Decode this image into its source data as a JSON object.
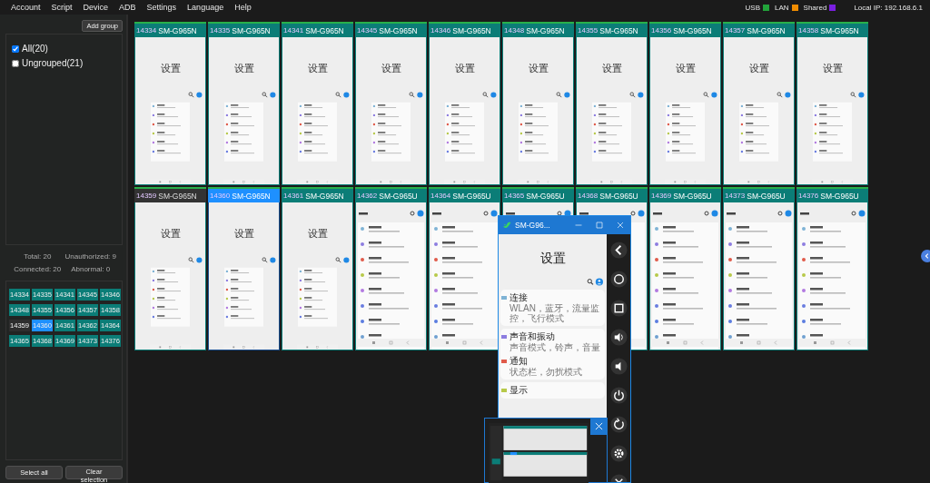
{
  "menu": [
    "Account",
    "Script",
    "Device",
    "ADB",
    "Settings",
    "Language",
    "Help"
  ],
  "legend": [
    {
      "label": "USB",
      "color": "#22a33a"
    },
    {
      "label": "LAN",
      "color": "#f08c00"
    },
    {
      "label": "Shared",
      "color": "#7a1fe0"
    }
  ],
  "local_ip": "Local IP: 192.168.6.1",
  "sidebar": {
    "add_group": "Add group",
    "groups": [
      {
        "label": "All(20)",
        "checked": true
      },
      {
        "label": "Ungrouped(21)",
        "checked": false
      }
    ],
    "stats": [
      "Total: 20",
      "Unauthorized: 9",
      "Connected: 20",
      "Abnormal: 0"
    ],
    "ports": [
      {
        "label": "14334",
        "selected": false,
        "dimmed": false
      },
      {
        "label": "14335",
        "selected": false,
        "dimmed": false
      },
      {
        "label": "14341",
        "selected": false,
        "dimmed": false
      },
      {
        "label": "14345",
        "selected": false,
        "dimmed": false
      },
      {
        "label": "14346",
        "selected": false,
        "dimmed": false
      },
      {
        "label": "14348",
        "selected": false,
        "dimmed": false
      },
      {
        "label": "14355",
        "selected": false,
        "dimmed": false
      },
      {
        "label": "14356",
        "selected": false,
        "dimmed": false
      },
      {
        "label": "14357",
        "selected": false,
        "dimmed": false
      },
      {
        "label": "14358",
        "selected": false,
        "dimmed": false
      },
      {
        "label": "14359",
        "selected": false,
        "dimmed": true
      },
      {
        "label": "14360",
        "selected": true,
        "dimmed": false
      },
      {
        "label": "14361",
        "selected": false,
        "dimmed": false
      },
      {
        "label": "14362",
        "selected": false,
        "dimmed": false
      },
      {
        "label": "14364",
        "selected": false,
        "dimmed": false
      },
      {
        "label": "14365",
        "selected": false,
        "dimmed": false
      },
      {
        "label": "14368",
        "selected": false,
        "dimmed": false
      },
      {
        "label": "14369",
        "selected": false,
        "dimmed": false
      },
      {
        "label": "14373",
        "selected": false,
        "dimmed": false
      },
      {
        "label": "14376",
        "selected": false,
        "dimmed": false
      }
    ],
    "buttons": [
      "Select all",
      "Clear selection"
    ]
  },
  "devices": [
    {
      "port": "14334",
      "model": "SM-G965N",
      "kind": "large",
      "title": "设置",
      "selected": false,
      "dimmed": false
    },
    {
      "port": "14335",
      "model": "SM-G965N",
      "kind": "large",
      "title": "设置",
      "selected": false,
      "dimmed": false
    },
    {
      "port": "14341",
      "model": "SM-G965N",
      "kind": "large",
      "title": "设置",
      "selected": false,
      "dimmed": false
    },
    {
      "port": "14345",
      "model": "SM-G965N",
      "kind": "large",
      "title": "设置",
      "selected": false,
      "dimmed": false
    },
    {
      "port": "14346",
      "model": "SM-G965N",
      "kind": "large",
      "title": "设置",
      "selected": false,
      "dimmed": false
    },
    {
      "port": "14348",
      "model": "SM-G965N",
      "kind": "large",
      "title": "设置",
      "selected": false,
      "dimmed": false
    },
    {
      "port": "14355",
      "model": "SM-G965N",
      "kind": "large",
      "title": "设置",
      "selected": false,
      "dimmed": false
    },
    {
      "port": "14356",
      "model": "SM-G965N",
      "kind": "large",
      "title": "设置",
      "selected": false,
      "dimmed": false
    },
    {
      "port": "14357",
      "model": "SM-G965N",
      "kind": "large",
      "title": "设置",
      "selected": false,
      "dimmed": false
    },
    {
      "port": "14358",
      "model": "SM-G965N",
      "kind": "large",
      "title": "设置",
      "selected": false,
      "dimmed": false
    },
    {
      "port": "14359",
      "model": "SM-G965N",
      "kind": "large",
      "title": "设置",
      "selected": false,
      "dimmed": true
    },
    {
      "port": "14360",
      "model": "SM-G965N",
      "kind": "large",
      "title": "设置",
      "selected": true,
      "dimmed": false
    },
    {
      "port": "14361",
      "model": "SM-G965N",
      "kind": "large",
      "title": "设置",
      "selected": false,
      "dimmed": false
    },
    {
      "port": "14362",
      "model": "SM-G965U",
      "kind": "compact",
      "selected": false,
      "dimmed": false
    },
    {
      "port": "14364",
      "model": "SM-G965U",
      "kind": "compact",
      "selected": false,
      "dimmed": false
    },
    {
      "port": "14365",
      "model": "SM-G965U",
      "kind": "compact",
      "selected": false,
      "dimmed": false
    },
    {
      "port": "14368",
      "model": "SM-G965U",
      "kind": "compact",
      "selected": false,
      "dimmed": false
    },
    {
      "port": "14369",
      "model": "SM-G965U",
      "kind": "compact",
      "selected": false,
      "dimmed": false
    },
    {
      "port": "14373",
      "model": "SM-G965U",
      "kind": "compact",
      "selected": false,
      "dimmed": false
    },
    {
      "port": "14376",
      "model": "SM-G965U",
      "kind": "compact",
      "selected": false,
      "dimmed": false
    }
  ],
  "mirror_window": {
    "title": "SM-G96...",
    "screen_title": "设置",
    "cards": [
      {
        "items": [
          {
            "title": "连接",
            "subtitle": "WLAN，蓝牙，流量监控，飞行模式"
          }
        ]
      },
      {
        "items": [
          {
            "title": "声音和振动",
            "subtitle": "声音模式，铃声，音量"
          },
          {
            "title": "通知",
            "subtitle": "状态栏，勿扰模式"
          }
        ]
      },
      {
        "items": [
          {
            "title": "显示"
          }
        ]
      }
    ]
  }
}
